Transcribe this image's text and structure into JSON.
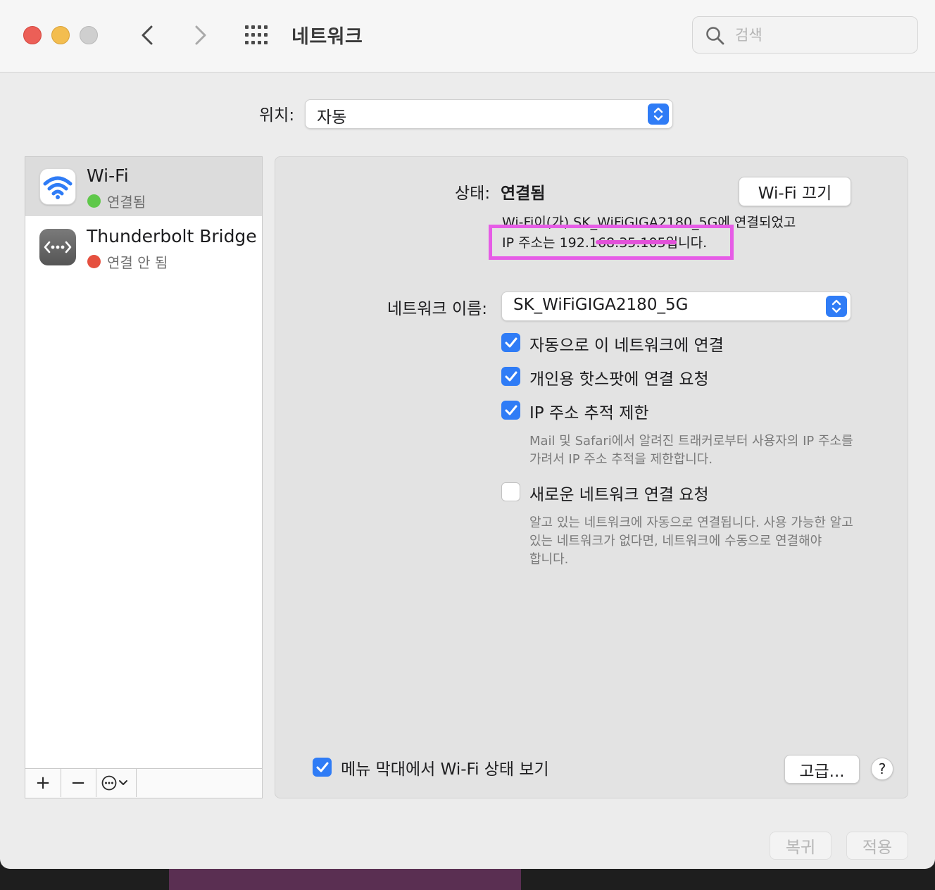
{
  "window": {
    "title": "네트워크",
    "search_placeholder": "검색"
  },
  "location": {
    "label": "위치:",
    "value": "자동"
  },
  "sidebar": {
    "services": [
      {
        "name": "Wi-Fi",
        "status": "연결됨",
        "status_color": "#5fc84a"
      },
      {
        "name": "Thunderbolt Bridge",
        "status": "연결 안 됨",
        "status_color": "#e5503f"
      }
    ],
    "toolbar": {
      "add": "+",
      "remove": "−"
    }
  },
  "panel": {
    "status_label": "상태:",
    "status_value": "연결됨",
    "wifi_off_button": "Wi-Fi 끄기",
    "status_desc_line1": "Wi-Fi이(가) SK_WiFiGIGA2180_5G에 연결되었고",
    "status_desc_line2": "IP 주소는 192.168.35.105입니다.",
    "network_name_label": "네트워크 이름:",
    "network_name_value": "SK_WiFiGIGA2180_5G",
    "options": [
      {
        "label": "자동으로 이 네트워크에 연결",
        "checked": true
      },
      {
        "label": "개인용 핫스팟에 연결 요청",
        "checked": true
      },
      {
        "label": "IP 주소 추적 제한",
        "checked": true
      },
      {
        "label": "새로운 네트워크 연결 요청",
        "checked": false
      }
    ],
    "ip_tracking_help": [
      "Mail 및 Safari에서 알려진 트래커로부터 사용자의 IP 주소를",
      "가려서 IP 주소 추적을 제한합니다."
    ],
    "ask_join_help": [
      "알고 있는 네트워크에 자동으로 연결됩니다. 사용 가능한 알고",
      "있는 네트워크가 없다면, 네트워크에 수동으로 연결해야",
      "합니다."
    ],
    "menubar_label": "메뉴 막대에서 Wi-Fi 상태 보기",
    "menubar_checked": true,
    "advanced_button": "고급...",
    "help_button": "?"
  },
  "footer": {
    "revert": "복귀",
    "apply": "적용"
  },
  "colors": {
    "accent": "#2f7cf6",
    "highlight": "#e65ce6"
  }
}
